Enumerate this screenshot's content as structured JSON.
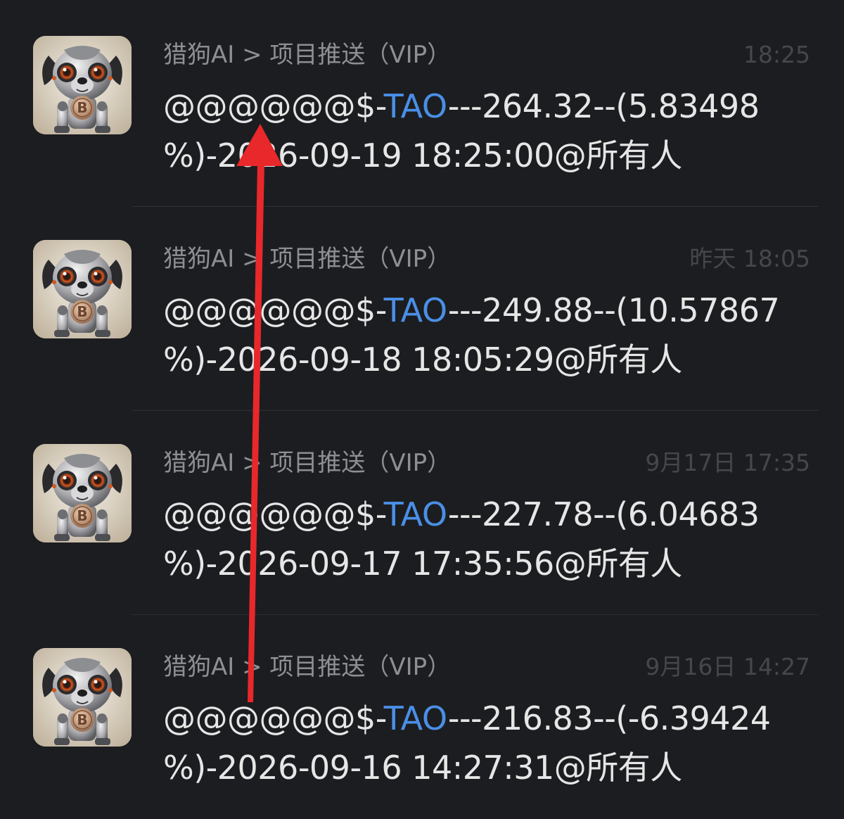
{
  "messages": [
    {
      "sender": "猎狗AI > 项目推送（VIP）",
      "time": "18:25",
      "prefix": "@@@@@@$-",
      "token": "TAO",
      "line1_rest": "---264.32--(5.83498",
      "line2": "%)-2026-09-19 18:25:00@所有人"
    },
    {
      "sender": "猎狗AI > 项目推送（VIP）",
      "time": "昨天 18:05",
      "prefix": "@@@@@@$-",
      "token": "TAO",
      "line1_rest": "---249.88--(10.57867",
      "line2": "%)-2026-09-18 18:05:29@所有人"
    },
    {
      "sender": "猎狗AI > 项目推送（VIP）",
      "time": "9月17日 17:35",
      "prefix": "@@@@@@$-",
      "token": "TAO",
      "line1_rest": "---227.78--(6.04683",
      "line2": "%)-2026-09-17 17:35:56@所有人"
    },
    {
      "sender": "猎狗AI > 项目推送（VIP）",
      "time": "9月16日 14:27",
      "prefix": "@@@@@@$-",
      "token": "TAO",
      "line1_rest": "---216.83--(-6.39424",
      "line2": "%)-2026-09-16 14:27:31@所有人"
    }
  ],
  "colors": {
    "background": "#1c1d20",
    "token": "#4a8fe7",
    "arrow": "#e8282b",
    "sender_text": "#8e8f94",
    "time_text": "#46474b"
  },
  "icons": {
    "avatar": "robot-dog-avatar-icon",
    "annotation": "red-arrow-up"
  }
}
